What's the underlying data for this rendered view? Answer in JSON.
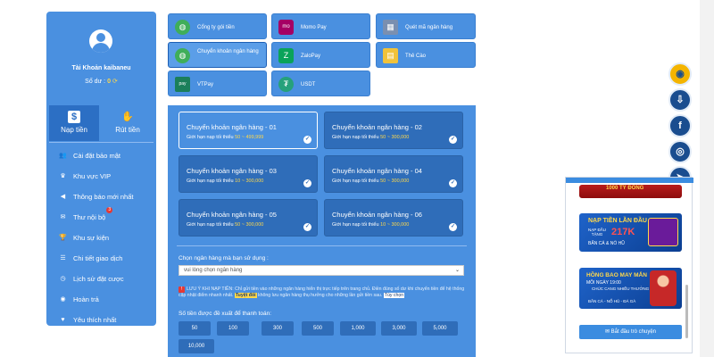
{
  "account": {
    "name": "Tài Khoản kaibaneu",
    "balance_label": "Số dư :",
    "balance_value": "0"
  },
  "tabs": [
    {
      "label": "Nạp tiền"
    },
    {
      "label": "Rút tiền"
    }
  ],
  "menu": [
    {
      "label": "Cài đặt bảo mật",
      "icon": "users-icon"
    },
    {
      "label": "Khu vực VIP",
      "icon": "crown-icon"
    },
    {
      "label": "Thông báo mới nhất",
      "icon": "megaphone-icon"
    },
    {
      "label": "Thư nội bộ",
      "icon": "mail-icon",
      "badge": "3"
    },
    {
      "label": "Khu sự kiện",
      "icon": "trophy-icon"
    },
    {
      "label": "Chi tiết giao dịch",
      "icon": "list-icon"
    },
    {
      "label": "Lịch sử đặt cược",
      "icon": "history-icon"
    },
    {
      "label": "Hoàn trả",
      "icon": "refund-icon"
    },
    {
      "label": "Yêu thích nhất",
      "icon": "heart-icon"
    }
  ],
  "methods": [
    {
      "label": "Cổng ty gói tiền",
      "icon": "globe-icon"
    },
    {
      "label": "Momo Pay",
      "icon": "momo-icon"
    },
    {
      "label": "Quét mã ngân hàng",
      "icon": "qr-icon"
    },
    {
      "label": "Chuyển khoản ngân hàng",
      "icon": "globe-icon"
    },
    {
      "label": "ZaloPay",
      "icon": "zalopay-icon"
    },
    {
      "label": "Thẻ Cào",
      "icon": "card-icon"
    },
    {
      "label": "VTPay",
      "icon": "viettelpay-icon"
    },
    {
      "label": "USDT",
      "icon": "tether-icon"
    }
  ],
  "banks": [
    {
      "title": "Chuyển khoản ngân hàng - 01",
      "limit_label": "Giới hạn nạp tối thiểu",
      "limit": "50 ~ 499,999"
    },
    {
      "title": "Chuyển khoản ngân hàng - 02",
      "limit_label": "Giới hạn nạp tối thiểu",
      "limit": "50 ~ 300,000"
    },
    {
      "title": "Chuyển khoản ngân hàng - 03",
      "limit_label": "Giới hạn nạp tối thiểu",
      "limit": "10 ~ 300,000"
    },
    {
      "title": "Chuyển khoản ngân hàng - 04",
      "limit_label": "Giới hạn nạp tối thiểu",
      "limit": "50 ~ 300,000"
    },
    {
      "title": "Chuyển khoản ngân hàng - 05",
      "limit_label": "Giới hạn nạp tối thiểu",
      "limit": "50 ~ 300,000"
    },
    {
      "title": "Chuyển khoản ngân hàng - 06",
      "limit_label": "Giới hạn nạp tối thiểu",
      "limit": "10 ~ 300,000"
    }
  ],
  "choose_bank": {
    "label": "Chọn ngân hàng mà bạn sử dụng :",
    "placeholder": "vui lòng chọn ngân hàng"
  },
  "notice": {
    "text_a": "LƯU Ý KHI NẠP TIỀN: Chỉ gửi tiền vào những ngân hàng hiển thị trực tiếp trên trang chủ. Điền đúng số dư khi chuyển tiền để hệ thống cập nhật điểm nhanh nhất.",
    "tag": "Tuyệt đối",
    "text_b": "không lưu ngân hàng thụ hưởng cho những lần gửi tiền sau.",
    "tag2": "Tùy chọn"
  },
  "amount": {
    "label": "Số tiền được đề xuất để thanh toán:",
    "options": [
      "50",
      "100",
      "300",
      "500",
      "1,000",
      "3,000",
      "5,000",
      "10,000"
    ]
  },
  "promos": {
    "b1": "1000 TỶ ĐỒNG",
    "b2_title": "NẠP TIỀN LẦN ĐẦU",
    "b2_sub": "NẠP ĐẦU TẶNG",
    "b2_amount": "217K",
    "b2_foot": "BẮN CÁ & NỔ HŨ",
    "b3_title": "HỒNG BAO MAY MẮN",
    "b3_sub": "MỖI NGÀY 19:00",
    "b3_sub2": "CHÚC CANG NHIỀU THƯỞNG CÀNG LỚN",
    "b3_foot": "BẮN CÁ - NỔ HŨ - ĐÁ GÀ"
  },
  "chat_button": "Bắt đầu trò chuyện",
  "social": [
    "logo-icon",
    "download-icon",
    "facebook-icon",
    "instagram-icon",
    "telegram-icon"
  ]
}
